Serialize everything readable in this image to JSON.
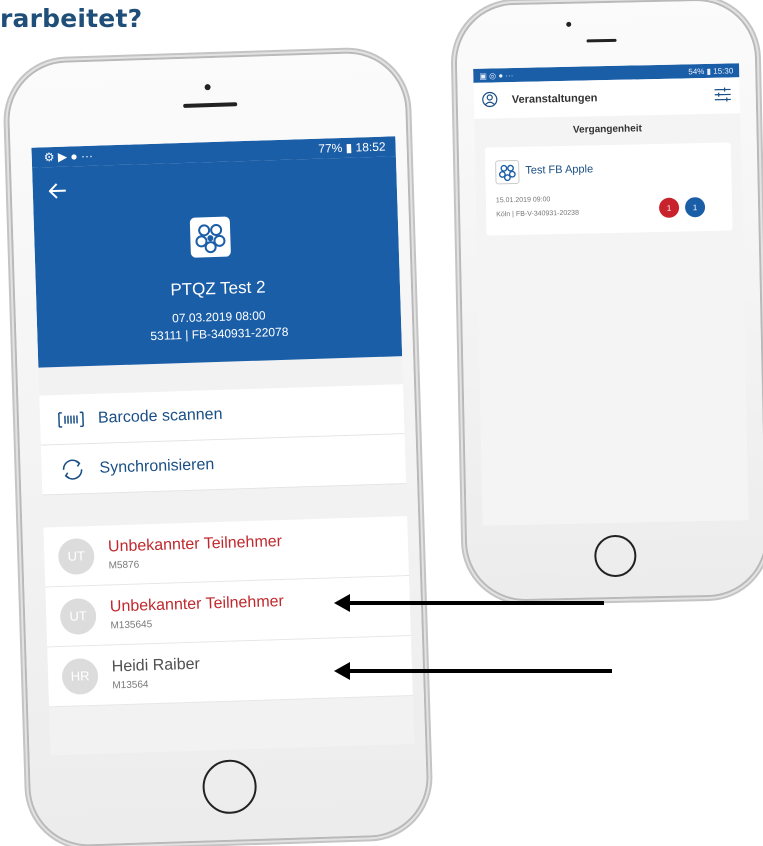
{
  "heading": {
    "text": "rarbeitet?"
  },
  "left_phone": {
    "status": {
      "left_icons": "⚙ ▶ ● ···",
      "right": "77% ▮ 18:52"
    },
    "event": {
      "title": "PTQZ Test 2",
      "date": "07.03.2019 08:00",
      "location": "53111 | FB-340931-22078"
    },
    "actions": [
      {
        "label": "Barcode scannen",
        "icon": "barcode-icon"
      },
      {
        "label": "Synchronisieren",
        "icon": "sync-icon"
      }
    ],
    "participants": [
      {
        "initials": "UT",
        "name": "Unbekannter Teilnehmer",
        "id": "M5876",
        "color": "#c0282d"
      },
      {
        "initials": "UT",
        "name": "Unbekannter Teilnehmer",
        "id": "M135645",
        "color": "#c0282d"
      },
      {
        "initials": "HR",
        "name": "Heidi Raiber",
        "id": "M13564",
        "color": "#505050"
      }
    ]
  },
  "right_phone": {
    "status": {
      "left_icons": "▣ ◎ ● ···",
      "right": "54% ▮ 15:30"
    },
    "title": "Veranstaltungen",
    "section": "Vergangenheit",
    "card": {
      "title": "Test FB Apple",
      "date": "15.01.2019 09:00",
      "location": "Köln | FB-V-340931-20238",
      "badge_red": "1",
      "badge_blue": "1"
    }
  },
  "colors": {
    "primary": "#1a5ea8",
    "heading": "#1f4e79",
    "unknown": "#c0282d"
  }
}
